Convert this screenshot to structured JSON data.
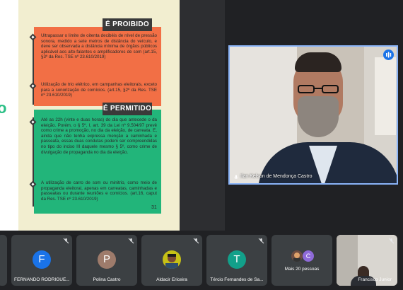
{
  "slide": {
    "prohibited_title": "É PROIBIDO",
    "permitted_title": "É PERMITIDO",
    "left_glyph": "o",
    "prohibited_items": [
      "Ultrapassar o limite de oitenta decibéis de nível de pressão sonora, medido a sete metros de distância do veículo, e deve ser observada a distância mínima de órgãos públicos aplicável aos alto-falantes e amplificadores de som (art.15, §3º da Res. TSE nº 23.610/2019)",
      "Utilização de trio elétrico, em campanhas eleitorais, exceto para a sonorização de comícios. (art.15, §2º da Res. TSE nº 23.610/2019)"
    ],
    "permitted_items": [
      "Até as 22h (vinte e duas horas) do dia que antecede o da eleição. Porém, o § 5º, I, art. 39 da Lei nº 9.504/97 prevê como crime a promoção, no dia da eleição, de carreata. E, ainda que não tenha expressa menção a caminhada e passeata, essas duas condutas podem ser compreendidas no tipo do inciso III daquele mesmo § 5º, como crime de divulgação de propaganda no dia da eleição.",
      "A utilização de carro de som ou minitrio, como meio de propaganda eleitoral, apenas em carreatas, caminhadas e passeatas ou durante reuniões e comícios. (art.16, caput da Res. TSE nº 23.610/2019)"
    ],
    "page_number": "31"
  },
  "speaker": {
    "name": "Ilan Kelson de Mendonça Castro"
  },
  "participants": [
    {
      "name": "FERNANDO RODRIGUE...",
      "initial": "F",
      "color": "#1a73e8"
    },
    {
      "name": "Polina Castro",
      "initial": "P",
      "color": "#9e7b6b"
    },
    {
      "name": "Aldacir Ericeira",
      "initial": "",
      "color": "#c6c016"
    },
    {
      "name": "Tércio Fernandes de Sa...",
      "initial": "T",
      "color": "#12a08a"
    },
    {
      "name": "Mais 20 pessoas",
      "initial": "C",
      "color": "#8e6ad8"
    },
    {
      "name": "Francisco Junior",
      "initial": "",
      "color": "#6d6a66"
    }
  ],
  "colors": {
    "prohibited": "#f26f45",
    "permitted": "#22b57a",
    "active_speaker_border": "#8ab4f8"
  },
  "icons": [
    "mic-off-icon",
    "audio-indicator-icon",
    "mic-icon"
  ]
}
